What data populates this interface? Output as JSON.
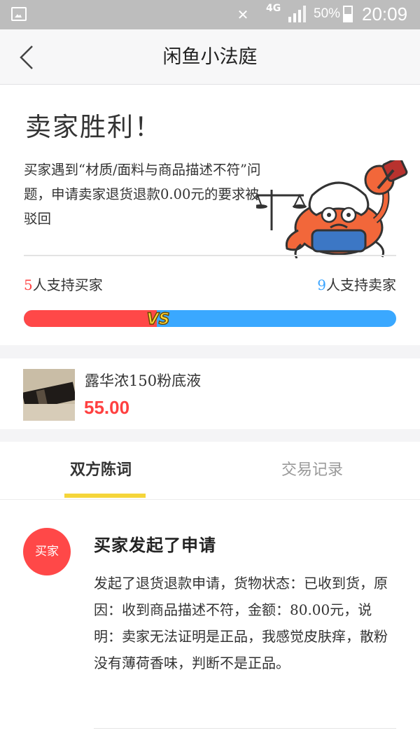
{
  "status_bar": {
    "network": "4G",
    "battery": "50%",
    "time": "20:09"
  },
  "header": {
    "title": "闲鱼小法庭"
  },
  "verdict": {
    "title": "卖家胜利！",
    "description": "买家遇到“材质/面料与商品描述不符”问题，申请卖家退货退款0.00元的要求被驳回",
    "buyer_support_count": "5",
    "buyer_support_label": "人支持买家",
    "seller_support_count": "9",
    "seller_support_label": "人支持卖家",
    "buyer_share": 0.357,
    "vs_label": "VS",
    "colors": {
      "buyer": "#ff4848",
      "seller": "#3aa8ff"
    }
  },
  "product": {
    "name": "露华浓150粉底液",
    "price": "55.00"
  },
  "tabs": [
    {
      "label": "双方陈词",
      "active": true
    },
    {
      "label": "交易记录",
      "active": false
    }
  ],
  "log": {
    "avatar_label": "买家",
    "title": "买家发起了申请",
    "body": "发起了退货退款申请，货物状态：已收到货，原因：收到商品描述不符，金额：80.00元，说明：卖家无法证明是正品，我感觉皮肤痒，散粉没有薄荷香味，判断不是正品。"
  }
}
